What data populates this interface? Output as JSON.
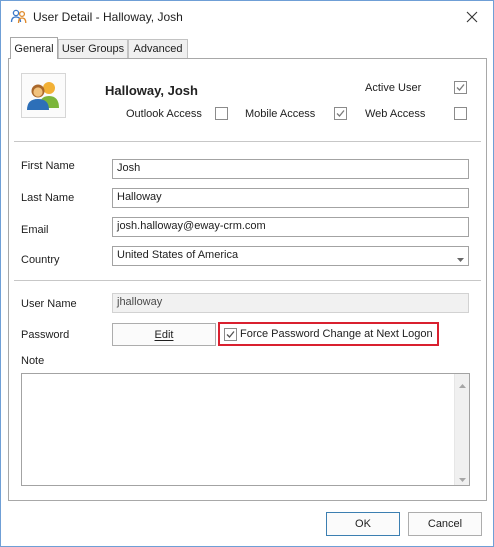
{
  "window": {
    "title": "User Detail - Halloway, Josh",
    "icon": "users-icon",
    "close_icon": "close-icon"
  },
  "tabs": [
    {
      "label": "General",
      "active": true
    },
    {
      "label": "User Groups",
      "active": false
    },
    {
      "label": "Advanced",
      "active": false
    }
  ],
  "header": {
    "avatar_icon": "users-avatar-icon",
    "display_name": "Halloway, Josh",
    "active_user_label": "Active User",
    "active_user_checked": true,
    "outlook_access_label": "Outlook Access",
    "outlook_access_checked": false,
    "mobile_access_label": "Mobile Access",
    "mobile_access_checked": true,
    "web_access_label": "Web Access",
    "web_access_checked": false
  },
  "form": {
    "first_name_label": "First Name",
    "first_name_value": "Josh",
    "last_name_label": "Last Name",
    "last_name_value": "Halloway",
    "email_label": "Email",
    "email_value": "josh.halloway@eway-crm.com",
    "country_label": "Country",
    "country_value": "United States of America",
    "username_label": "User Name",
    "username_value": "jhalloway",
    "password_label": "Password",
    "password_edit_label": "Edit",
    "force_password_label": "Force Password Change at Next Logon",
    "force_password_checked": true,
    "note_label": "Note",
    "note_value": ""
  },
  "footer": {
    "ok_label": "OK",
    "cancel_label": "Cancel"
  },
  "colors": {
    "highlight_border": "#d9202f",
    "primary_button_border": "#3c7fb1",
    "window_border": "#6f9fd6"
  }
}
